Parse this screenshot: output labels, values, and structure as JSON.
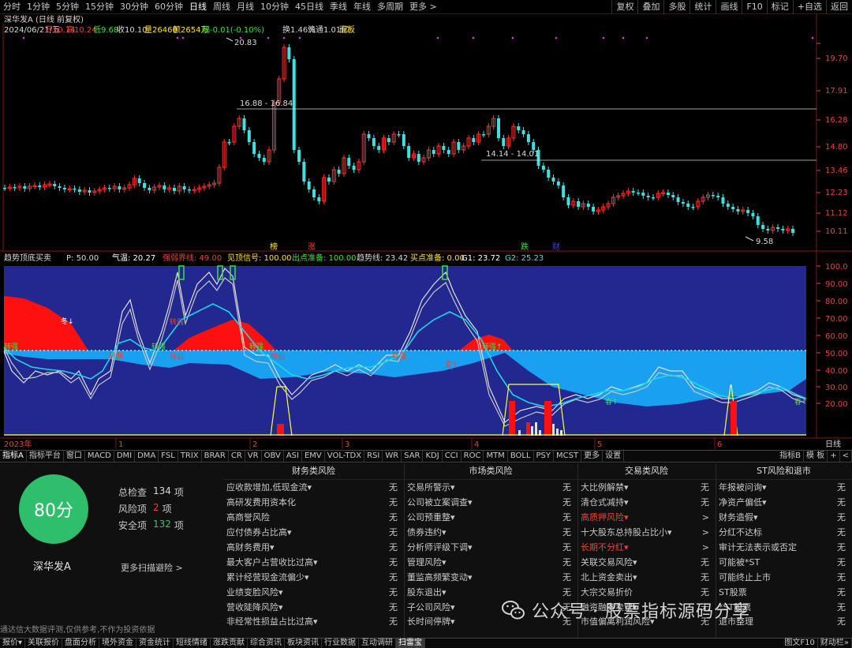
{
  "periods": [
    "分时",
    "1分钟",
    "5分钟",
    "15分钟",
    "30分钟",
    "60分钟",
    "日线",
    "周线",
    "月线",
    "10分钟",
    "45日线",
    "季线",
    "年线",
    "多周期",
    "更多 >"
  ],
  "active_period": "日线",
  "right_buttons": [
    "复权",
    "叠加",
    "多股",
    "统计",
    "画线",
    "F10",
    "标记",
    "+自选",
    "返回"
  ],
  "stock": {
    "title": "深华发A (日线 前复权)"
  },
  "quote": {
    "date": "2024/06/21/五",
    "open": "开10.14",
    "high": "高10.24",
    "low": "低9.68",
    "close": "收10.10",
    "volume": "量26460",
    "amount": "额2654万",
    "change": "幅-0.01(-0.10%)",
    "turnover": "换1.46%",
    "float": "流通1.01亿",
    "panel": "面板"
  },
  "price_axis": [
    "19.70",
    "17.91",
    "16.28",
    "14.80",
    "13.46",
    "12.23",
    "11.12",
    "10.11"
  ],
  "annotations": {
    "high": "20.83",
    "low": "9.58",
    "range1": "16.88 - 16.84",
    "range2": "14.14 - 14.01"
  },
  "markers": [
    "榜",
    "涨",
    "跌",
    "财"
  ],
  "indicator": {
    "name": "趋势顶底买卖",
    "params": [
      {
        "text": "P: 50.00",
        "color": "#d8d8d8"
      },
      {
        "text": "气温: 20.27",
        "color": "#ffffff"
      },
      {
        "text": "强弱界线: 49.00",
        "color": "#e8443a"
      },
      {
        "text": "见顶信号: 100.00",
        "color": "#ffe040"
      },
      {
        "text": "出点准备: 100.00",
        "color": "#40e040"
      },
      {
        "text": "趋势线: 23.42",
        "color": "#d8d8d8"
      },
      {
        "text": "买点准备: 0.00",
        "color": "#ffe040"
      },
      {
        "text": "G1: 23.72",
        "color": "#ffffff"
      },
      {
        "text": "G2: 25.23",
        "color": "#40e0e0"
      }
    ],
    "axis": [
      "100.0",
      "90.00",
      "80.00",
      "70.00",
      "60.00",
      "50.00",
      "40.00",
      "30.00",
      "20.00"
    ],
    "labels": [
      "冬↓",
      "转强",
      "转弱",
      "转强",
      "转弱",
      "转强",
      "转弱",
      "夏↑",
      "转强",
      "转强↑",
      "转弱",
      "春↑",
      "春↑"
    ]
  },
  "time_axis": {
    "year": "2023年",
    "months": [
      "1",
      "2",
      "3",
      "4",
      "5",
      "6"
    ],
    "unit": "日线"
  },
  "indicator_tabs": [
    "指标A",
    "指标平台",
    "窗口",
    "MACD",
    "DMI",
    "DMA",
    "FSL",
    "TRIX",
    "BRAR",
    "CR",
    "VR",
    "OBV",
    "ASI",
    "EMV",
    "VOL-TDX",
    "RSI",
    "WR",
    "SAR",
    "KDJ",
    "CCI",
    "ROC",
    "MTM",
    "BOLL",
    "PSY",
    "MCST",
    "更多",
    "设置"
  ],
  "indicator_tabs_right": [
    "指标B",
    "模 板",
    "+",
    "<"
  ],
  "score": {
    "value": "80分",
    "name": "深华发A",
    "more": "更多扫描避险 >"
  },
  "stats": [
    {
      "label": "总检查",
      "value": "134",
      "unit": "项",
      "color": "#d8d8d8"
    },
    {
      "label": "风险项",
      "value": "2",
      "unit": "项",
      "color": "#e8443a"
    },
    {
      "label": "安全项",
      "value": "132",
      "unit": "项",
      "color": "#3ec46d"
    }
  ],
  "disclaimer": "通达信大数据评测,仅供参考,不作为投资依据",
  "risk_columns": [
    {
      "title": "财务类风险",
      "items": [
        {
          "label": "应收款增加,低现金流▾",
          "status": "无"
        },
        {
          "label": "高研发费用资本化",
          "status": "无"
        },
        {
          "label": "高商誉风险",
          "status": "无"
        },
        {
          "label": "应付债券占比高▾",
          "status": "无"
        },
        {
          "label": "高财务费用▾",
          "status": "无"
        },
        {
          "label": "最大客户占营收比过高▾",
          "status": "无"
        },
        {
          "label": "累计经营现金流偏少▾",
          "status": "无"
        },
        {
          "label": "业绩变脸风险▾",
          "status": "无"
        },
        {
          "label": "营收陡降风险▾",
          "status": "无"
        },
        {
          "label": "非经常性损益占比过高▾",
          "status": "无"
        }
      ]
    },
    {
      "title": "市场类风险",
      "items": [
        {
          "label": "交易所警示▾",
          "status": "无"
        },
        {
          "label": "公司被立案调查▾",
          "status": "无"
        },
        {
          "label": "公司预重整▾",
          "status": "无"
        },
        {
          "label": "债券违约▾",
          "status": "无"
        },
        {
          "label": "分析师评级下调▾",
          "status": "无"
        },
        {
          "label": "管理风险▾",
          "status": "无"
        },
        {
          "label": "董监高频繁变动▾",
          "status": "无"
        },
        {
          "label": "股东退出▾",
          "status": "无"
        },
        {
          "label": "子公司风险▾",
          "status": "无"
        },
        {
          "label": "长时间停牌▾",
          "status": "无"
        }
      ]
    },
    {
      "title": "交易类风险",
      "items": [
        {
          "label": "大比例解禁▾",
          "status": "无"
        },
        {
          "label": "清仓式减持▾",
          "status": "无"
        },
        {
          "label": "高质押风险▾",
          "status": ">",
          "warn": true
        },
        {
          "label": "十大股东总持股占比小▾",
          "status": ">"
        },
        {
          "label": "长期不分红▾",
          "status": ">",
          "warn": true
        },
        {
          "label": "关联交易风险▾",
          "status": "无"
        },
        {
          "label": "北上资金卖出▾",
          "status": "无"
        },
        {
          "label": "大宗交易折价",
          "status": "无"
        },
        {
          "label": "融资融券卖空▾",
          "status": "无"
        },
        {
          "label": "市值偏离利润风险▾",
          "status": "无"
        }
      ]
    },
    {
      "title": "ST风险和退市",
      "items": [
        {
          "label": "年报被问询▾",
          "status": "无"
        },
        {
          "label": "净资产偏低▾",
          "status": "无"
        },
        {
          "label": "财务造假▾",
          "status": "无"
        },
        {
          "label": "分红不达标",
          "status": "无"
        },
        {
          "label": "审计无法表示或否定",
          "status": "无"
        },
        {
          "label": "可能被*ST",
          "status": "无"
        },
        {
          "label": "可能终止上市",
          "status": "无"
        },
        {
          "label": "ST股票",
          "status": "无"
        },
        {
          "label": "*ST股票",
          "status": "无"
        },
        {
          "label": "退市整理",
          "status": "无"
        }
      ]
    }
  ],
  "watermark": "公众号 · 股票指标源码分享",
  "status_tabs": [
    "报价▾",
    "关联报价",
    "盘面分析",
    "境外资金",
    "资金统计",
    "短线情绪",
    "涨跌贡献",
    "综合资讯",
    "板块资讯",
    "行业数据",
    "互动调研",
    "扫雷宝"
  ],
  "status_active": "扫雷宝",
  "status_right": [
    "图文F10",
    "财动栏»"
  ]
}
